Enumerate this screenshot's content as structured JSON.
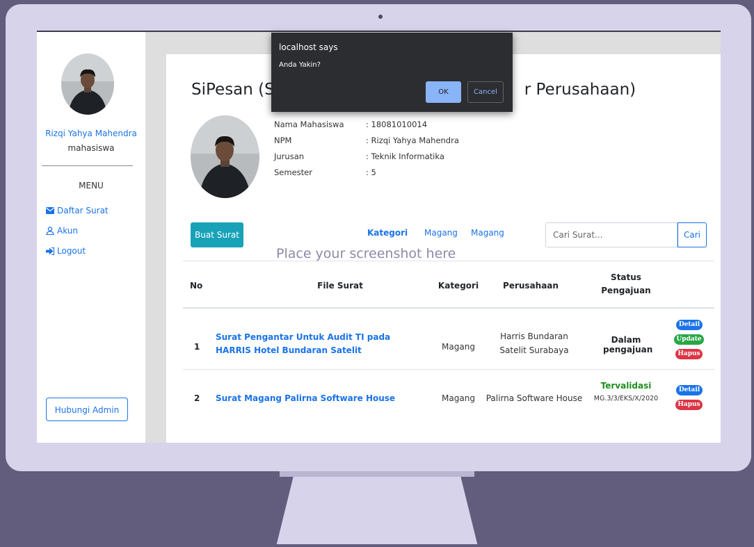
{
  "dialog": {
    "title": "localhost says",
    "message": "Anda Yakin?",
    "ok_label": "OK",
    "cancel_label": "Cancel"
  },
  "sidebar": {
    "user_name": "Rizqi Yahya Mahendra",
    "role": "mahasiswa",
    "menu_title": "MENU",
    "items": [
      {
        "label": "Daftar Surat",
        "icon": "envelope-icon"
      },
      {
        "label": "Akun",
        "icon": "user-icon"
      },
      {
        "label": "Logout",
        "icon": "logout-icon"
      }
    ],
    "contact_button": "Hubungi Admin"
  },
  "header": {
    "title": "SiPesan (S",
    "title_tail": "r Perusahaan)"
  },
  "profile": {
    "fields": [
      {
        "label": "Nama Mahasiswa",
        "value": ": 18081010014"
      },
      {
        "label": "NPM",
        "value": ": Rizqi Yahya Mahendra"
      },
      {
        "label": "Jurusan",
        "value": ": Teknik Informatika"
      },
      {
        "label": "Semester",
        "value": ": 5"
      }
    ]
  },
  "toolbar": {
    "create_button": "Buat Surat",
    "filter_label": "Kategori",
    "filter_options": [
      "Magang",
      "Magang"
    ],
    "search_placeholder": "Cari Surat...",
    "search_button": "Cari"
  },
  "overlay_text": "Place your screenshot here",
  "table": {
    "headers": [
      "No",
      "File Surat",
      "Kategori",
      "Perusahaan",
      "Status Pengajuan"
    ],
    "rows": [
      {
        "no": "1",
        "file": "Surat Pengantar Untuk Audit TI pada HARRIS Hotel Bundaran Satelit",
        "category": "Magang",
        "company": "Harris Bundaran Satelit Surabaya",
        "status": "Dalam pengajuan",
        "status_code": "",
        "actions": [
          "Detail",
          "Update",
          "Hapus"
        ]
      },
      {
        "no": "2",
        "file": "Surat Magang Palirna Software House",
        "category": "Magang",
        "company": "Palirna Software House",
        "status": "Tervalidasi",
        "status_code": "MG.3/3/EKS/X/2020",
        "actions": [
          "Detail",
          "Hapus"
        ]
      }
    ]
  },
  "colors": {
    "link": "#1a73e8",
    "primary_button": "#17a2b8",
    "success": "#28a745",
    "danger": "#dc3545",
    "validated": "#1e8e1e"
  }
}
